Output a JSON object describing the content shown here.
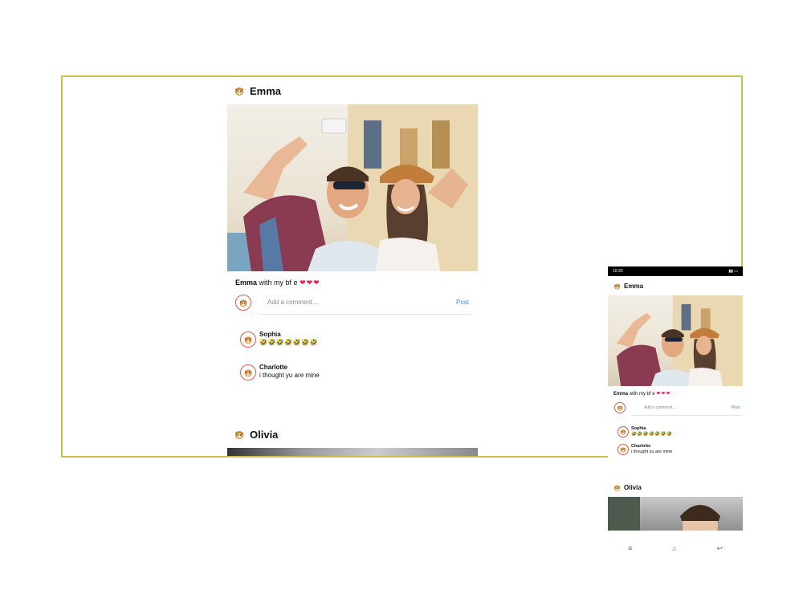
{
  "colors": {
    "frame_border": "#c9c24a",
    "accent_link": "#3a8fd8",
    "heart": "#e2235a",
    "avatar_ring": "#e0584a"
  },
  "desktop": {
    "posts": [
      {
        "user": "Emma",
        "caption_user": "Emma",
        "caption_text": "with my bf e",
        "caption_emoji": "❤❤❤",
        "comment_placeholder": "Add a comment...",
        "post_label": "Post",
        "comments": [
          {
            "user": "Sophia",
            "text": "🤣🤣🤣🤣🤣🤣🤣"
          },
          {
            "user": "Charlotte",
            "text": "i thought yu are mine"
          }
        ]
      },
      {
        "user": "Olivia"
      }
    ]
  },
  "mobile": {
    "status_time": "10:20",
    "status_right": "▮▮ ▭",
    "post1": {
      "user": "Emma",
      "caption_user": "Emma",
      "caption_text": "with my bf e",
      "caption_emoji": "❤❤❤",
      "comment_placeholder": "Add a comment...",
      "post_label": "Post",
      "comments": [
        {
          "user": "Sophia",
          "text": "🤣🤣🤣🤣🤣🤣🤣"
        },
        {
          "user": "Charlotte",
          "text": "i thought yu are mine"
        }
      ]
    },
    "post2": {
      "user": "Olivia"
    },
    "nav": {
      "menu": "≡",
      "home": "⌂",
      "back": "↩"
    }
  }
}
